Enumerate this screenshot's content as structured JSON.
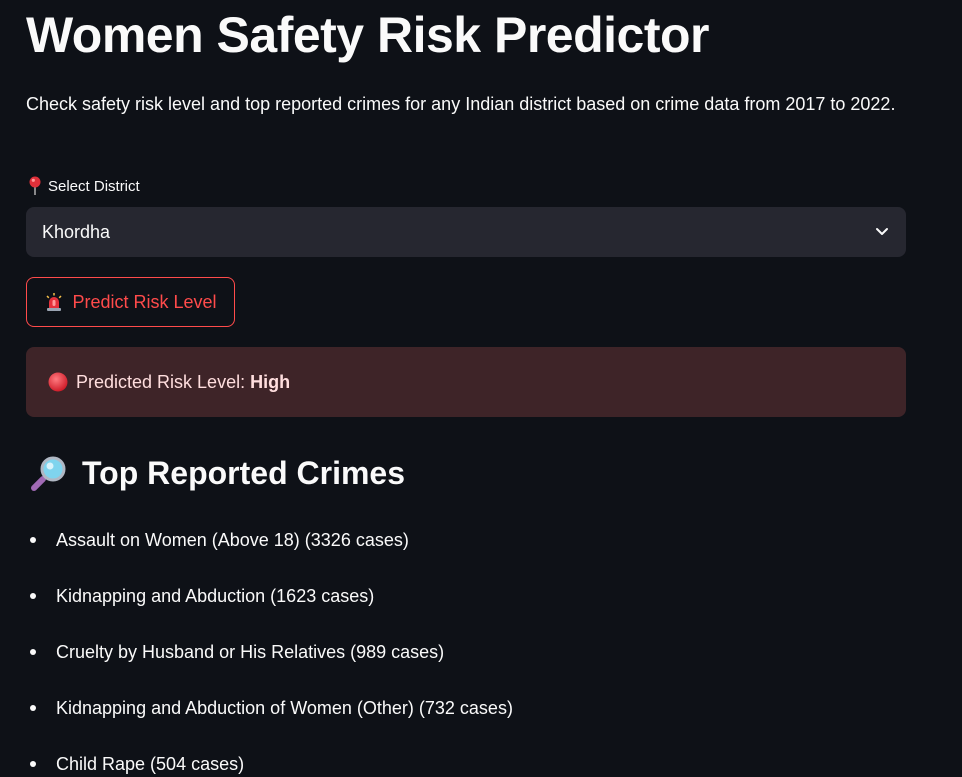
{
  "header": {
    "title": "Women Safety Risk Predictor",
    "description": "Check safety risk level and top reported crimes for any Indian district based on crime data from 2017 to 2022."
  },
  "district_select": {
    "icon": "pushpin-icon",
    "label": "Select District",
    "value": "Khordha"
  },
  "predict_button": {
    "icon": "police-light-icon",
    "label": "Predict Risk Level",
    "color": "#ff4b4b"
  },
  "result": {
    "icon": "red-circle-icon",
    "prefix": "Predicted Risk Level:",
    "level": "High",
    "background": "#3e2428"
  },
  "top_crimes": {
    "icon": "magnifying-glass-icon",
    "heading": "Top Reported Crimes",
    "items": [
      "Assault on Women (Above 18) (3326 cases)",
      "Kidnapping and Abduction (1623 cases)",
      "Cruelty by Husband or His Relatives (989 cases)",
      "Kidnapping and Abduction of Women (Other) (732 cases)",
      "Child Rape (504 cases)"
    ]
  },
  "theme": {
    "background": "#0e1117",
    "input_background": "#262730",
    "accent": "#ff4b4b"
  }
}
